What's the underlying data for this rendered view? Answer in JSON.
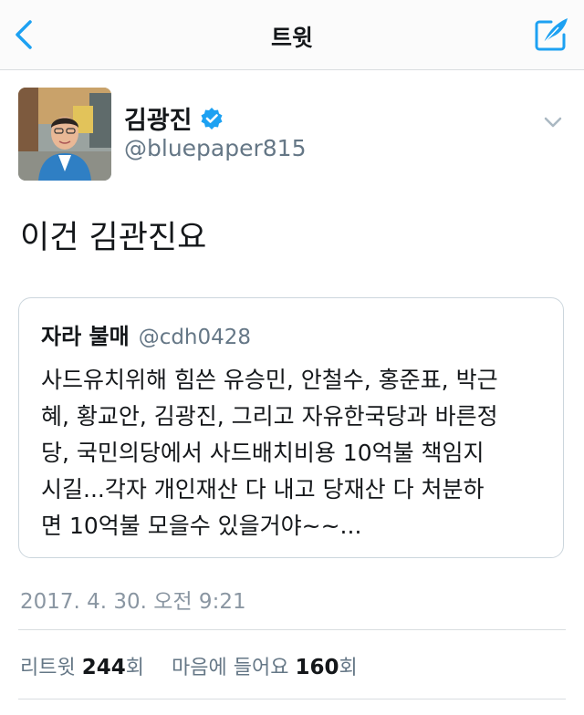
{
  "navbar": {
    "title": "트윗",
    "back_icon": "chevron-left-icon",
    "compose_icon": "compose-feather-icon",
    "accent_color": "#1da1f2"
  },
  "author": {
    "display_name": "김광진",
    "handle": "@bluepaper815",
    "verified": true,
    "verified_icon": "verified-badge-icon",
    "menu_icon": "chevron-down-icon"
  },
  "tweet": {
    "text": "이건 김관진요",
    "timestamp": "2017. 4. 30. 오전 9:21"
  },
  "quoted_tweet": {
    "display_name": "자라 불매",
    "handle": "@cdh0428",
    "lines": [
      "사드유치위해 힘쓴 유승민, 안철수, 홍준표, 박근",
      "혜, 황교안, 김광진, 그리고 자유한국당과 바른정",
      "당, 국민의당에서 사드배치비용 10억불 책임지",
      "시길...각자 개인재산 다 내고 당재산 다 처분하",
      "면 10억불 모을수 있을거야~~..."
    ]
  },
  "stats": {
    "retweets_label": "리트윗",
    "retweets_count": "244",
    "retweets_suffix": "회",
    "likes_label": "마음에 들어요",
    "likes_count": "160",
    "likes_suffix": "회"
  }
}
